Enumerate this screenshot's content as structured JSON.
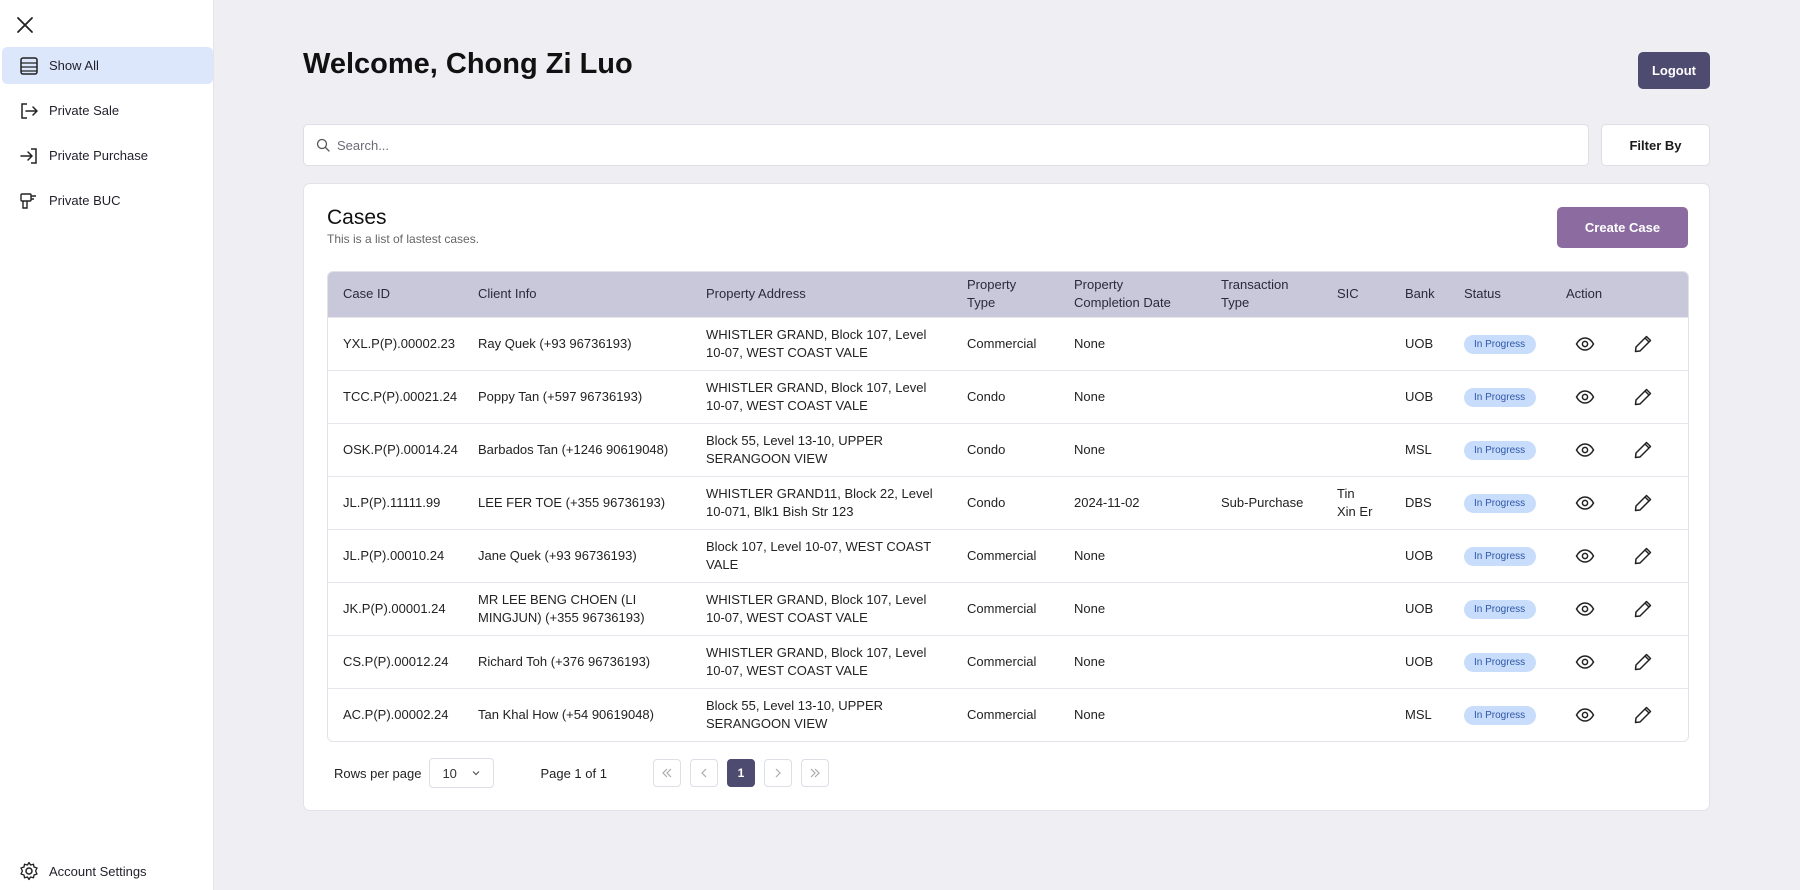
{
  "sidebar": {
    "items": [
      {
        "label": "Show All",
        "icon": "list-icon",
        "active": true
      },
      {
        "label": "Private Sale",
        "icon": "exit-arrow-icon"
      },
      {
        "label": "Private Purchase",
        "icon": "enter-arrow-icon"
      },
      {
        "label": "Private BUC",
        "icon": "drill-icon"
      }
    ],
    "account_label": "Account Settings"
  },
  "header": {
    "welcome": "Welcome, Chong Zi Luo",
    "logout_label": "Logout"
  },
  "search": {
    "placeholder": "Search...",
    "value": "",
    "filter_label": "Filter By"
  },
  "cases": {
    "title": "Cases",
    "subtitle": "This is a list of lastest cases.",
    "create_label": "Create Case",
    "columns": [
      "Case ID",
      "Client Info",
      "Property Address",
      "Property Type",
      "Property Completion Date",
      "Transaction Type",
      "SIC",
      "Bank",
      "Status",
      "Action"
    ],
    "rows": [
      {
        "case_id": "YXL.P(P).00002.23",
        "client": "Ray Quek (+93 96736193)",
        "address": "WHISTLER GRAND, Block 107, Level 10-07, WEST COAST VALE",
        "type": "Commercial",
        "completion": "None",
        "transaction": "",
        "sic": "",
        "bank": "UOB",
        "status": "In Progress"
      },
      {
        "case_id": "TCC.P(P).00021.24",
        "client": "Poppy Tan (+597 96736193)",
        "address": "WHISTLER GRAND, Block 107, Level 10-07, WEST COAST VALE",
        "type": "Condo",
        "completion": "None",
        "transaction": "",
        "sic": "",
        "bank": "UOB",
        "status": "In Progress"
      },
      {
        "case_id": "OSK.P(P).00014.24",
        "client": "Barbados Tan (+1246 90619048)",
        "address": "Block 55, Level 13-10, UPPER SERANGOON VIEW",
        "type": "Condo",
        "completion": "None",
        "transaction": "",
        "sic": "",
        "bank": "MSL",
        "status": "In Progress"
      },
      {
        "case_id": "JL.P(P).11111.99",
        "client": "LEE FER TOE (+355 96736193)",
        "address": "WHISTLER GRAND11, Block 22, Level 10-071, Blk1 Bish Str 123",
        "type": "Condo",
        "completion": "2024-11-02",
        "transaction": "Sub-Purchase",
        "sic": "Tin Xin Er",
        "bank": "DBS",
        "status": "In Progress"
      },
      {
        "case_id": "JL.P(P).00010.24",
        "client": "Jane Quek (+93 96736193)",
        "address": "Block 107, Level 10-07, WEST COAST VALE",
        "type": "Commercial",
        "completion": "None",
        "transaction": "",
        "sic": "",
        "bank": "UOB",
        "status": "In Progress"
      },
      {
        "case_id": "JK.P(P).00001.24",
        "client": "MR LEE BENG CHOEN (LI MINGJUN) (+355 96736193)",
        "address": "WHISTLER GRAND, Block 107, Level 10-07, WEST COAST VALE",
        "type": "Commercial",
        "completion": "None",
        "transaction": "",
        "sic": "",
        "bank": "UOB",
        "status": "In Progress"
      },
      {
        "case_id": "CS.P(P).00012.24",
        "client": "Richard Toh (+376 96736193)",
        "address": "WHISTLER GRAND, Block 107, Level 10-07, WEST COAST VALE",
        "type": "Commercial",
        "completion": "None",
        "transaction": "",
        "sic": "",
        "bank": "UOB",
        "status": "In Progress"
      },
      {
        "case_id": "AC.P(P).00002.24",
        "client": "Tan Khal How (+54 90619048)",
        "address": "Block 55, Level 13-10, UPPER SERANGOON VIEW",
        "type": "Commercial",
        "completion": "None",
        "transaction": "",
        "sic": "",
        "bank": "MSL",
        "status": "In Progress"
      }
    ]
  },
  "pagination": {
    "rows_label": "Rows per page",
    "rows_value": "10",
    "page_info": "Page 1 of 1",
    "current_page": "1"
  },
  "colors": {
    "primary": "#4d4b70",
    "accent": "#8b6ba0",
    "header_bg": "#c9c7da",
    "badge_bg": "#c8ddfb",
    "active_nav": "#dde7fb"
  }
}
